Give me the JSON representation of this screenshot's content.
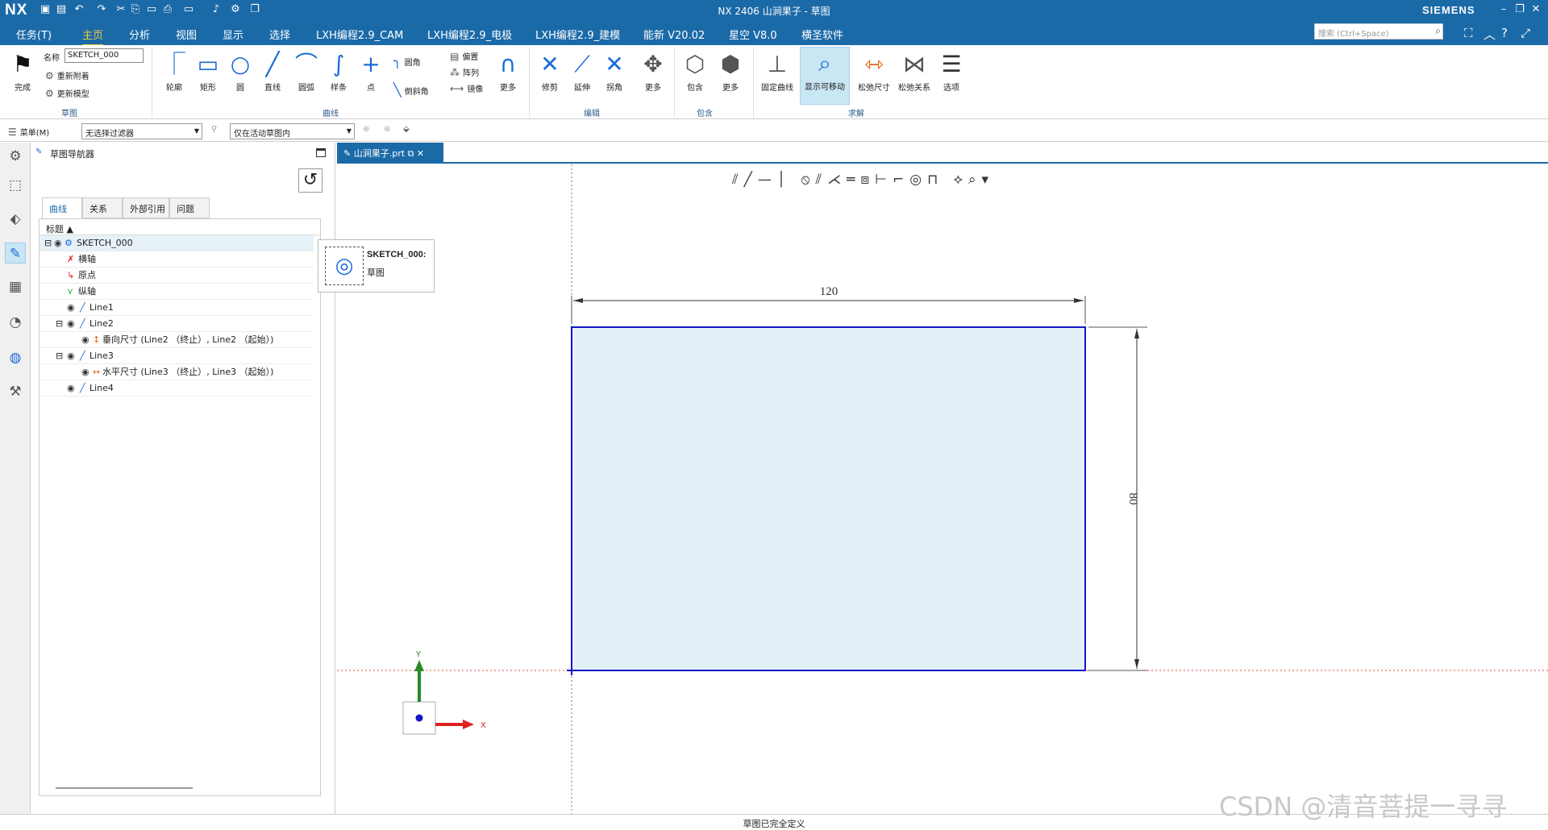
{
  "window": {
    "title": "NX 2406 山涧果子 - 草图",
    "logo": "NX",
    "brand": "SIEMENS"
  },
  "menu": {
    "items": [
      "任务(T)",
      "主页",
      "分析",
      "视图",
      "显示",
      "选择",
      "LXH编程2.9_CAM",
      "LXH编程2.9_电极",
      "LXH编程2.9_建模",
      "能新 V20.02",
      "星空 V8.0",
      "横圣软件"
    ],
    "search_placeholder": "搜索 (Ctrl+Space)"
  },
  "ribbon": {
    "sketch": {
      "finish": "完成",
      "name_label": "名称",
      "name_value": "SKETCH_000",
      "reattach": "重新附着",
      "update_model": "更新模型",
      "group": "草图"
    },
    "curve": {
      "items": [
        "轮廓",
        "矩形",
        "圆",
        "直线",
        "圆弧",
        "样条",
        "点"
      ],
      "fillet": "圆角",
      "chamfer": "倒斜角",
      "offset": "偏置",
      "pattern": "阵列",
      "mirror": "镜像",
      "more": "更多",
      "group": "曲线"
    },
    "edit": {
      "items": [
        "修剪",
        "延伸",
        "拐角",
        "更多"
      ],
      "group": "编辑"
    },
    "include": {
      "items": [
        "包含",
        "更多"
      ],
      "group": "包含"
    },
    "solve": {
      "items": [
        "固定曲线",
        "显示可移动",
        "松弛尺寸",
        "松弛关系",
        "选项"
      ],
      "group": "求解"
    }
  },
  "selbar": {
    "menu": "菜单(M)",
    "filter": "无选择过滤器",
    "scope": "仅在活动草图内"
  },
  "navigator": {
    "title": "草图导航器",
    "tabs": [
      "曲线",
      "关系",
      "外部引用",
      "问题"
    ],
    "column": "标题",
    "rows": [
      {
        "label": "SKETCH_000"
      },
      {
        "label": "横轴"
      },
      {
        "label": "原点"
      },
      {
        "label": "纵轴"
      },
      {
        "label": "Line1"
      },
      {
        "label": "Line2"
      },
      {
        "label": "垂向尺寸 (Line2 （终止）, Line2 （起始）)"
      },
      {
        "label": "Line3"
      },
      {
        "label": "水平尺寸 (Line3 （终止）, Line3 （起始）)"
      },
      {
        "label": "Line4"
      }
    ]
  },
  "document": {
    "tab": "山涧果子.prt"
  },
  "tooltip": {
    "title": "SKETCH_000:",
    "subtitle": "草图"
  },
  "sketch": {
    "dim_h": "120",
    "dim_v": "80",
    "axis_x": "X",
    "axis_y": "Y"
  },
  "status": "草图已完全定义",
  "watermark": "CSDN @清音菩提一寻寻",
  "colors": {
    "accent": "#1b6aa8",
    "sketch_fill": "#e3f0f7",
    "sketch_line": "#1515c8"
  }
}
